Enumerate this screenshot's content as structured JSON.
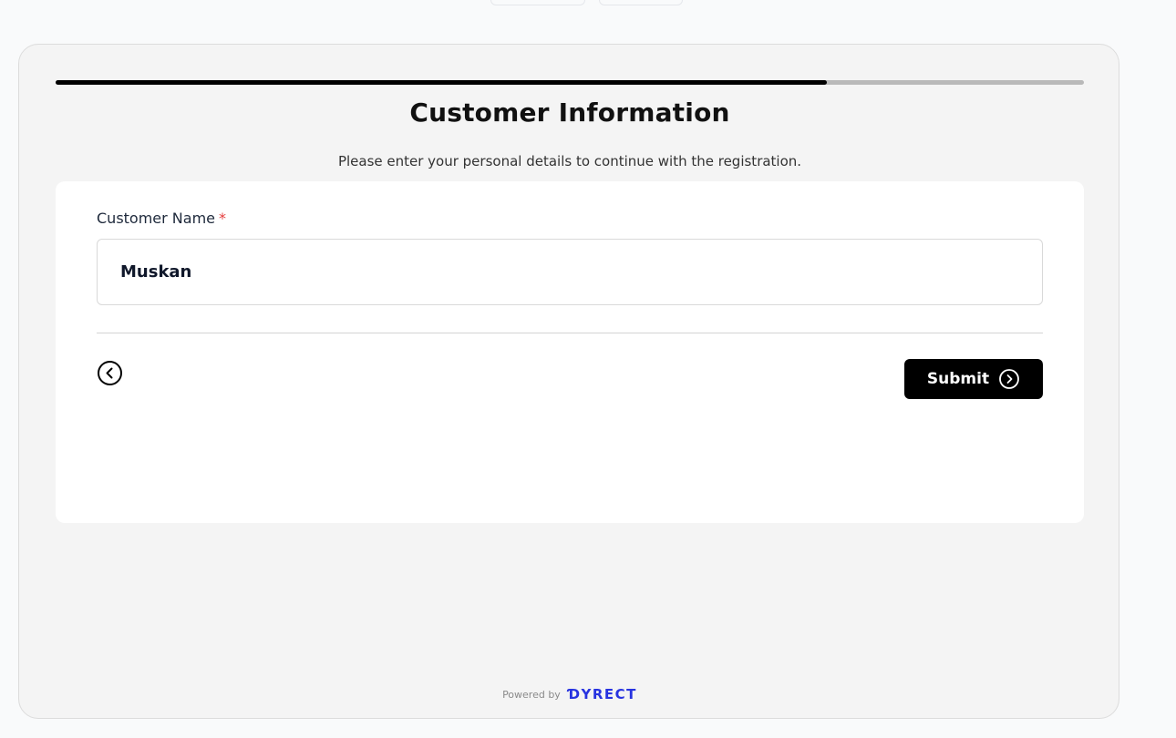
{
  "progress": {
    "value_percent": 75
  },
  "header": {
    "title": "Customer Information",
    "subtitle": "Please enter your personal details to continue with the registration."
  },
  "form": {
    "customer_name_label": "Customer Name",
    "required_marker": "*",
    "customer_name_value": "Muskan"
  },
  "actions": {
    "back_icon": "chevron-left-circle-icon",
    "submit_label": "Submit",
    "submit_icon": "chevron-right-circle-icon"
  },
  "footer": {
    "powered_by": "Powered by",
    "brand": "ƊYRECT"
  },
  "colors": {
    "accent": "#000000",
    "brand": "#2733e0",
    "required": "#e53e3e"
  }
}
